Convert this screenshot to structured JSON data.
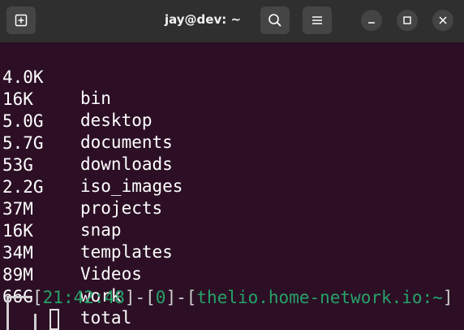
{
  "titlebar": {
    "title": "jay@dev: ~",
    "new_tab_icon": "new-tab-icon",
    "search_icon": "search-icon",
    "menu_icon": "hamburger-menu-icon",
    "minimize_icon": "minimize-icon",
    "maximize_icon": "maximize-icon",
    "close_icon": "close-icon"
  },
  "terminal": {
    "lines": [
      {
        "size": "4.0K",
        "name": "bin"
      },
      {
        "size": "16K",
        "name": "desktop"
      },
      {
        "size": "5.0G",
        "name": "documents"
      },
      {
        "size": "5.7G",
        "name": "downloads"
      },
      {
        "size": "53G",
        "name": "iso_images"
      },
      {
        "size": "2.2G",
        "name": "projects"
      },
      {
        "size": "37M",
        "name": "snap"
      },
      {
        "size": "16K",
        "name": "templates"
      },
      {
        "size": "34M",
        "name": "Videos"
      },
      {
        "size": "89M",
        "name": "work"
      },
      {
        "size": "66G",
        "name": "total"
      }
    ],
    "prompt": {
      "open1": "[",
      "time": "21:42:48",
      "close1": "]",
      "dash1": "-",
      "open2": "[",
      "code": "0",
      "close2": "]",
      "dash2": "-",
      "open3": "[",
      "host": "thelio.home-network.io:~",
      "close3": "]"
    }
  },
  "colors": {
    "terminal_bg": "#2c0f25",
    "titlebar_bg": "#2f2f2f",
    "prompt_green": "#26a269"
  }
}
